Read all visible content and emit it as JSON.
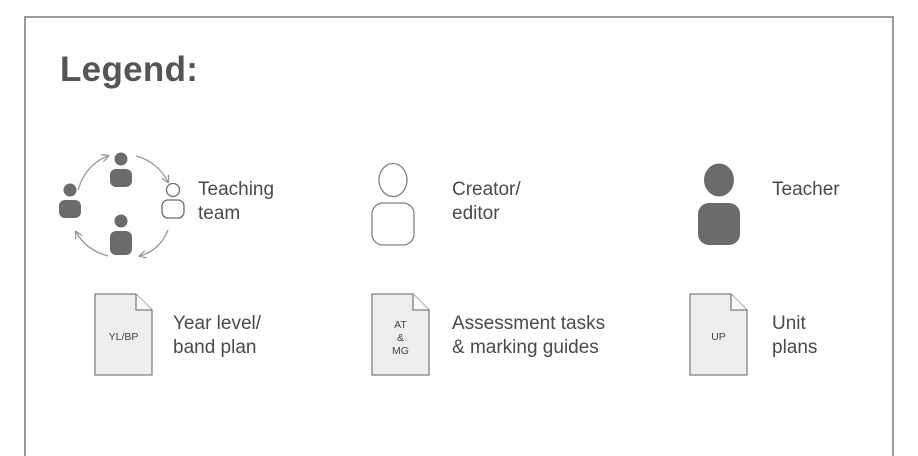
{
  "legend": {
    "title": "Legend:",
    "items": [
      {
        "id": "teaching-team",
        "icon": "teaching-team-icon",
        "label_lines": [
          "Teaching",
          "team"
        ]
      },
      {
        "id": "creator-editor",
        "icon": "person-outline-icon",
        "label_lines": [
          "Creator/",
          "editor"
        ]
      },
      {
        "id": "teacher",
        "icon": "person-filled-icon",
        "label_lines": [
          "Teacher"
        ]
      },
      {
        "id": "year-level-plan",
        "icon": "document-icon",
        "doc_text": [
          "YL/BP"
        ],
        "label_lines": [
          "Year level/",
          "band plan"
        ]
      },
      {
        "id": "assessment-tasks",
        "icon": "document-icon",
        "doc_text": [
          "AT",
          "&",
          "MG"
        ],
        "label_lines": [
          "Assessment tasks",
          "& marking guides"
        ]
      },
      {
        "id": "unit-plans",
        "icon": "document-icon",
        "doc_text": [
          "UP"
        ],
        "label_lines": [
          "Unit",
          "plans"
        ]
      }
    ]
  },
  "colors": {
    "icon_fill": "#6b6b6b",
    "outline": "#808080",
    "doc_fill": "#eeeeee",
    "frame": "#9a9a9a"
  }
}
